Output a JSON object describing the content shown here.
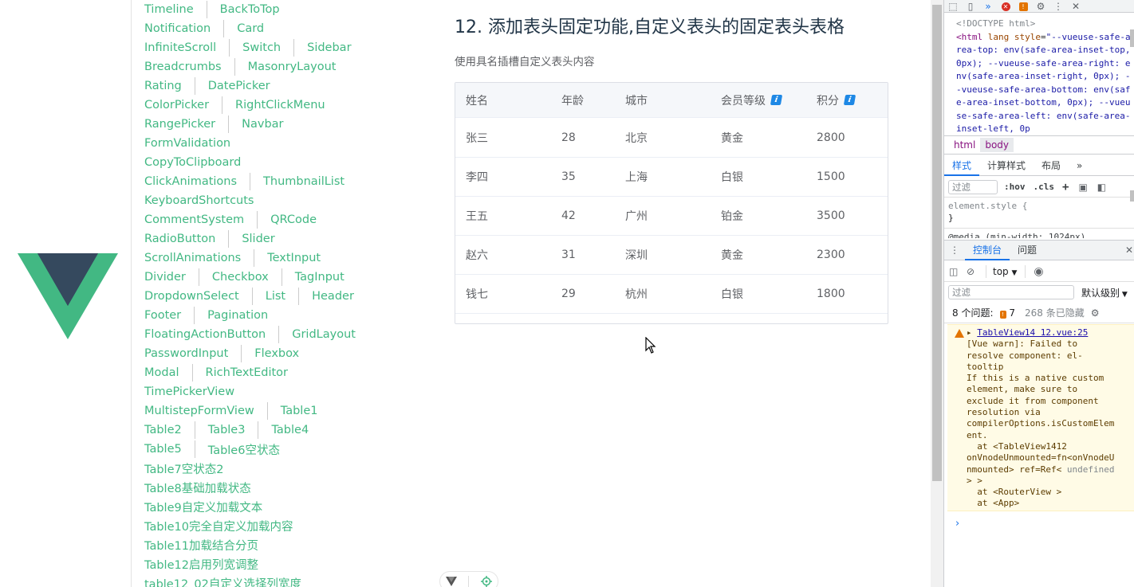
{
  "nav": {
    "rows": [
      [
        "Timeline",
        "BackToTop"
      ],
      [
        "Notification",
        "Card"
      ],
      [
        "InfiniteScroll",
        "Switch",
        "Sidebar"
      ],
      [
        "Breadcrumbs",
        "MasonryLayout"
      ],
      [
        "Rating",
        "DatePicker"
      ],
      [
        "ColorPicker",
        "RightClickMenu"
      ],
      [
        "RangePicker",
        "Navbar"
      ],
      [
        "FormValidation"
      ],
      [
        "CopyToClipboard"
      ],
      [
        "ClickAnimations",
        "ThumbnailList"
      ],
      [
        "KeyboardShortcuts"
      ],
      [
        "CommentSystem",
        "QRCode"
      ],
      [
        "RadioButton",
        "Slider"
      ],
      [
        "ScrollAnimations",
        "TextInput"
      ],
      [
        "Divider",
        "Checkbox",
        "TagInput"
      ],
      [
        "DropdownSelect",
        "List",
        "Header"
      ],
      [
        "Footer",
        "Pagination"
      ],
      [
        "FloatingActionButton",
        "GridLayout"
      ],
      [
        "PasswordInput",
        "Flexbox"
      ],
      [
        "Modal",
        "RichTextEditor"
      ],
      [
        "TimePickerView"
      ],
      [
        "MultistepFormView",
        "Table1"
      ],
      [
        "Table2",
        "Table3",
        "Table4"
      ],
      [
        "Table5",
        "Table6空状态"
      ],
      [
        "Table7空状态2"
      ],
      [
        "Table8基础加载状态"
      ],
      [
        "Table9自定义加载文本"
      ],
      [
        "Table10完全自定义加载内容"
      ],
      [
        "Table11加载结合分页"
      ],
      [
        "Table12启用列宽调整"
      ],
      [
        "table12_02自定义选择列宽度"
      ]
    ],
    "link_color": "#42b883"
  },
  "main": {
    "title": "12. 添加表头固定功能,自定义表头的固定表头表格",
    "subtitle": "使用具名插槽自定义表头内容"
  },
  "table": {
    "columns": [
      {
        "label": "姓名",
        "info": false
      },
      {
        "label": "年龄",
        "info": false
      },
      {
        "label": "城市",
        "info": false
      },
      {
        "label": "会员等级",
        "info": true
      },
      {
        "label": "积分",
        "info": true
      }
    ],
    "info_icon_glyph": "i",
    "rows": [
      [
        "张三",
        "28",
        "北京",
        "黄金",
        "2800"
      ],
      [
        "李四",
        "35",
        "上海",
        "白银",
        "1500"
      ],
      [
        "王五",
        "42",
        "广州",
        "铂金",
        "3500"
      ],
      [
        "赵六",
        "31",
        "深圳",
        "黄金",
        "2300"
      ],
      [
        "钱七",
        "29",
        "杭州",
        "白银",
        "1800"
      ]
    ]
  },
  "vue_bar": {
    "icons": [
      "vue-logo-icon",
      "target-icon"
    ]
  },
  "devtools": {
    "toolbar": {
      "error_count": "",
      "warning_count": ""
    },
    "dom": {
      "doctype": "<!DOCTYPE html>",
      "html_open_tag": "<html",
      "html_attr_lang": "lang",
      "html_attr_style": "style",
      "html_style_value": "\"--vueuse-safe-area-top: env(safe-area-inset-top, 0px); --vueuse-safe-area-right: env(safe-area-inset-right, 0px); --vueuse-safe-area-bottom: env(safe-area-inset-bottom, 0px); --vueuse-safe-area-left: env(safe-area-inset-left, 0p"
    },
    "breadcrumbs": [
      "html",
      "body"
    ],
    "styles_tabs": [
      "样式",
      "计算样式",
      "布局",
      "»"
    ],
    "styles_filter_placeholder": "过滤",
    "styles_buttons": {
      "hov": ":hov",
      "cls": ".cls",
      "plus": "+"
    },
    "styles_rules": {
      "element_style": "element.style {",
      "element_style_close": "}",
      "media": "@media (min-width: 1024px)"
    },
    "drawer_tabs": [
      "控制台",
      "问题"
    ],
    "console_toolbar": {
      "context": "top"
    },
    "console_filter_placeholder": "过滤",
    "console_level": "默认级别",
    "issues": {
      "label": "8 个问题:",
      "count": "7",
      "hidden": "268 条已隐藏"
    },
    "message": {
      "source": "TableView14 12.vue:25",
      "lines": [
        "[Vue warn]: Failed to",
        "resolve component: el-",
        "tooltip",
        "If this is a native custom",
        "element, make sure to",
        "exclude it from component",
        "resolution via",
        "compilerOptions.isCustomElem",
        "ent.",
        "  at <TableView1412",
        "onVnodeUnmounted=fn<onVnodeU",
        "nmounted> ref=Ref<"
      ],
      "undefined_text": "undefined",
      "tail_lines": [
        "> >",
        "  at <RouterView >",
        "  at <App>"
      ]
    },
    "prompt": "›"
  }
}
